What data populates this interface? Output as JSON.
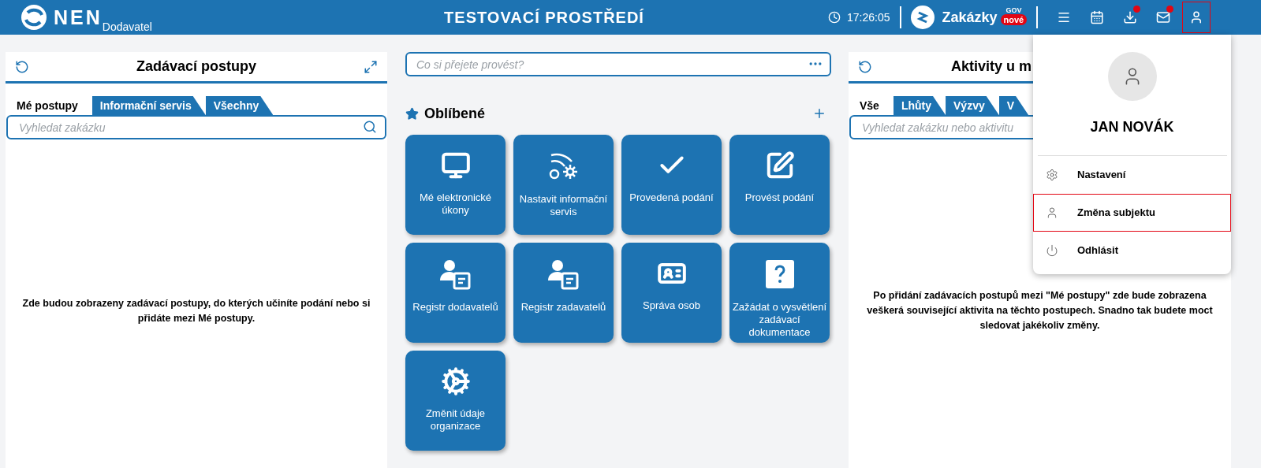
{
  "header": {
    "logo": "NEN",
    "role": "Dodavatel",
    "title": "TESTOVACÍ PROSTŘEDÍ",
    "time": "17:26:05",
    "brand": {
      "name": "Zakázky",
      "sup": "GOV",
      "badge": "nové"
    },
    "icons": [
      {
        "kind": "menu",
        "badge": false,
        "selected": false
      },
      {
        "kind": "calendar",
        "badge": false,
        "selected": false
      },
      {
        "kind": "download",
        "badge": true,
        "selected": false
      },
      {
        "kind": "mail",
        "badge": true,
        "selected": false
      },
      {
        "kind": "user",
        "badge": false,
        "selected": true
      }
    ]
  },
  "left_panel": {
    "title": "Zadávací postupy",
    "tabs": [
      {
        "label": "Mé postupy",
        "selected": true
      },
      {
        "label": "Informační servis",
        "selected": false
      },
      {
        "label": "Všechny",
        "selected": false
      }
    ],
    "search": {
      "placeholder": "Vyhledat zakázku"
    },
    "empty_message": "Zde budou zobrazeny zadávací postupy, do kterých učiníte podání nebo si přidáte mezi Mé postupy."
  },
  "command": {
    "placeholder": "Co si přejete provést?"
  },
  "favorites": {
    "title": "Oblíbené",
    "tiles": [
      {
        "label": "Mé elektronické úkony"
      },
      {
        "label": "Nastavit informační servis"
      },
      {
        "label": "Provedená podání"
      },
      {
        "label": "Provést podání"
      },
      {
        "label": "Registr dodavatelů"
      },
      {
        "label": "Registr zadavatelů"
      },
      {
        "label": "Správa osob"
      },
      {
        "label": "Zažádat o vysvětlení zadávací dokumentace"
      },
      {
        "label": "Změnit údaje organizace"
      }
    ]
  },
  "right_panel": {
    "title": "Aktivity u m",
    "tabs": [
      {
        "label": "Vše",
        "selected": true
      },
      {
        "label": "Lhůty",
        "selected": false
      },
      {
        "label": "Výzvy",
        "selected": false
      },
      {
        "label": "V",
        "selected": false
      }
    ],
    "search": {
      "placeholder": "Vyhledat zakázku nebo aktivitu"
    },
    "empty_message": "Po přidání zadávacích postupů mezi \"Mé postupy\" zde bude zobrazena veškerá související aktivita na těchto postupech. Snadno tak budete moct sledovat jakékoliv změny."
  },
  "user_menu": {
    "name": "JAN NOVÁK",
    "items": [
      {
        "kind": "settings",
        "label": "Nastavení",
        "selected": false
      },
      {
        "kind": "user",
        "label": "Změna subjektu",
        "selected": true
      },
      {
        "kind": "power",
        "label": "Odhlásit",
        "selected": false
      }
    ]
  }
}
